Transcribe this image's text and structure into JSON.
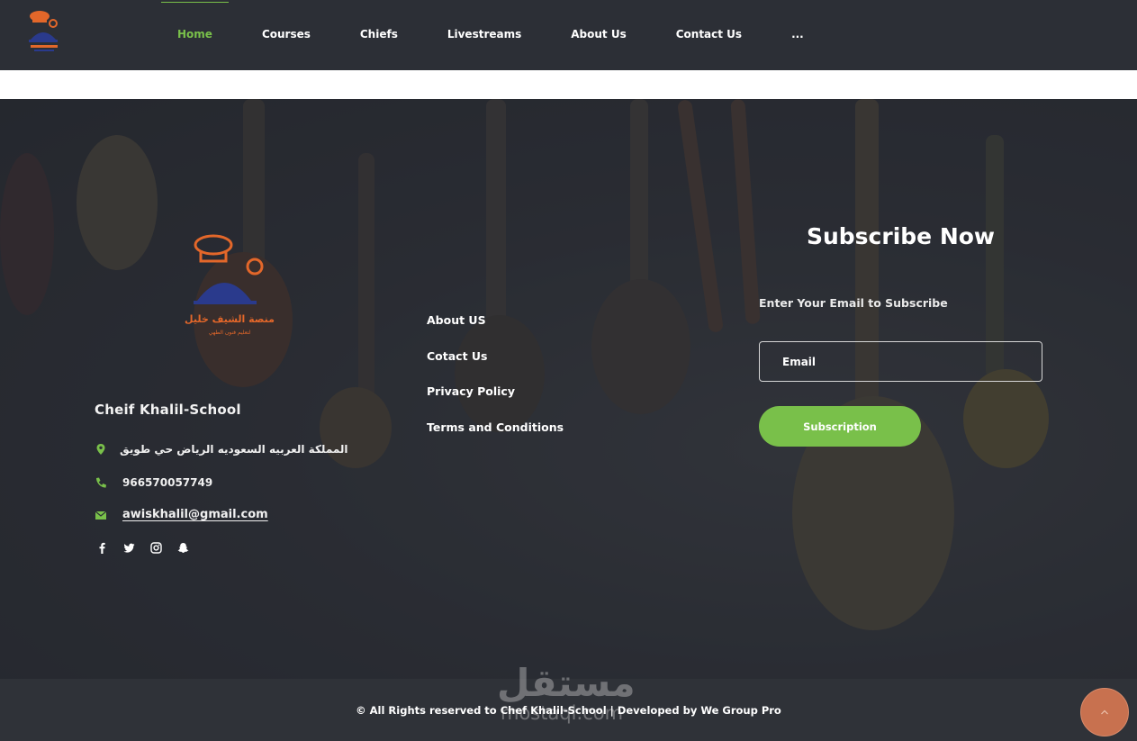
{
  "header": {
    "logo_icon": "chef-school-logo",
    "nav": [
      {
        "label": "Home",
        "active": true
      },
      {
        "label": "Courses",
        "active": false
      },
      {
        "label": "Chiefs",
        "active": false
      },
      {
        "label": "Livestreams",
        "active": false
      },
      {
        "label": "About Us",
        "active": false
      },
      {
        "label": "Contact Us",
        "active": false
      },
      {
        "label": "...",
        "active": false
      }
    ]
  },
  "footer": {
    "brand": {
      "logo_text_ar": "منصة الشيف خليل",
      "logo_sub_ar": "لتعليم فنون الطهي",
      "name": "Cheif Khalil-School"
    },
    "contact": {
      "address": "المملكة العربيه السعوديه الرياض حي طويق",
      "phone": "966570057749",
      "email": "awiskhalil@gmail.com"
    },
    "social_icons": [
      "facebook-icon",
      "twitter-icon",
      "instagram-icon",
      "snapchat-icon"
    ],
    "links": [
      "About US",
      "Cotact Us",
      "Privacy Policy",
      "Terms and Conditions"
    ],
    "subscribe": {
      "title": "Subscribe Now",
      "label": "Enter Your Email to Subscribe",
      "placeholder": "Email",
      "button": "Subscription"
    }
  },
  "bottom": {
    "copyright": "© All Rights reserved to Chef Khalil-School | Developed by We Group Pro",
    "watermark_ar": "مستقل",
    "watermark_en": "mostaql.com"
  },
  "colors": {
    "accent": "#79c04a",
    "dark_bg": "#2c2f36",
    "scroll_top": "#c8714f"
  }
}
